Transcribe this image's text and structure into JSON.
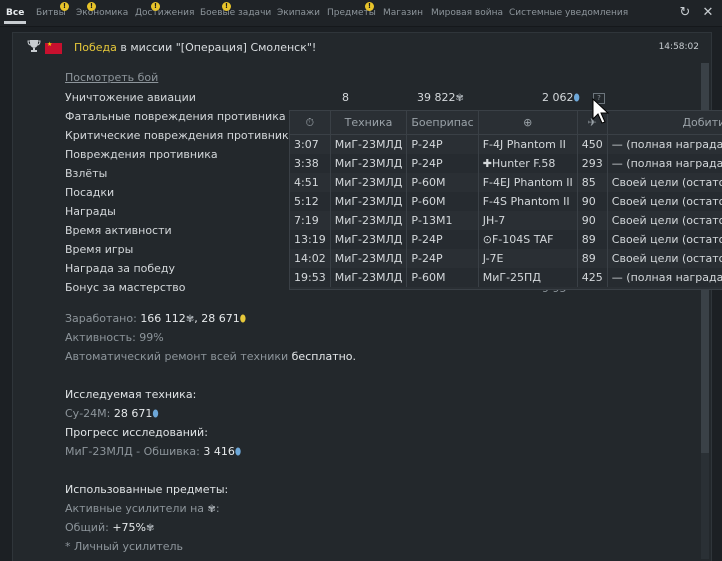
{
  "tabs": [
    {
      "label": "Все",
      "active": true,
      "badge": false
    },
    {
      "label": "Битвы",
      "active": false,
      "badge": true
    },
    {
      "label": "Экономика",
      "active": false,
      "badge": true
    },
    {
      "label": "Достижения",
      "active": false,
      "badge": true
    },
    {
      "label": "Боевые задачи",
      "active": false,
      "badge": true
    },
    {
      "label": "Экипажи",
      "active": false,
      "badge": false
    },
    {
      "label": "Предметы",
      "active": false,
      "badge": true
    },
    {
      "label": "Магазин",
      "active": false,
      "badge": false
    },
    {
      "label": "Мировая война",
      "active": false,
      "badge": false
    },
    {
      "label": "Системные уведомления",
      "active": false,
      "badge": false
    }
  ],
  "badge_symbol": "!",
  "message": {
    "victory_word": "Победа",
    "title_rest": " в миссии \"[Операция] Смоленск\"!",
    "time": "14:58:02",
    "replay_link": "Посмотреть бой"
  },
  "stats": [
    {
      "label": "Уничтожение авиации",
      "count": "8",
      "silver": "39 822",
      "rp": "2 062"
    },
    {
      "label": "Фатальные повреждения противника"
    },
    {
      "label": "Критические повреждения противника"
    },
    {
      "label": "Повреждения противника"
    },
    {
      "label": "Взлёты"
    },
    {
      "label": "Посадки"
    },
    {
      "label": "Награды"
    },
    {
      "label": "Время активности"
    },
    {
      "label": "Время игры"
    },
    {
      "label": "Награда за победу"
    },
    {
      "label": "Бонус за мастерство",
      "partial": "9 95"
    }
  ],
  "qmark": "?",
  "popup": {
    "headers": [
      "⏱",
      "Техника",
      "Боеприпас",
      "⊕",
      "✈",
      "Добитие"
    ],
    "rows": [
      {
        "time": "3:07",
        "vehicle": "МиГ-23МЛД",
        "ammo": "Р-24Р",
        "target": "F-4J Phantom II",
        "mark": "",
        "score": "450",
        "finish": "— (полная награда)"
      },
      {
        "time": "3:38",
        "vehicle": "МиГ-23МЛД",
        "ammo": "Р-24Р",
        "target": "Hunter F.58",
        "mark": "✚",
        "score": "293",
        "finish": "— (полная награда)"
      },
      {
        "time": "4:51",
        "vehicle": "МиГ-23МЛД",
        "ammo": "Р-60М",
        "target": "F-4EJ Phantom II",
        "mark": "",
        "score": "85",
        "finish": "Своей цели (остаток"
      },
      {
        "time": "5:12",
        "vehicle": "МиГ-23МЛД",
        "ammo": "Р-60М",
        "target": "F-4S Phantom II",
        "mark": "",
        "score": "90",
        "finish": "Своей цели (остаток"
      },
      {
        "time": "7:19",
        "vehicle": "МиГ-23МЛД",
        "ammo": "Р-13М1",
        "target": "JH-7",
        "mark": "",
        "score": "90",
        "finish": "Своей цели (остаток"
      },
      {
        "time": "13:19",
        "vehicle": "МиГ-23МЛД",
        "ammo": "Р-24Р",
        "target": "F-104S TAF",
        "mark": "⊙",
        "score": "89",
        "finish": "Своей цели (остаток"
      },
      {
        "time": "14:02",
        "vehicle": "МиГ-23МЛД",
        "ammo": "Р-24Р",
        "target": "J-7E",
        "mark": "",
        "score": "89",
        "finish": "Своей цели (остаток"
      },
      {
        "time": "19:53",
        "vehicle": "МиГ-23МЛД",
        "ammo": "Р-60М",
        "target": "МиГ-25ПД",
        "mark": "",
        "score": "425",
        "finish": "— (полная награда)"
      }
    ]
  },
  "earnings": {
    "earned_label": "Заработано: ",
    "earned_silver": "166 112",
    "earned_sep": ", ",
    "earned_rp": "28 671",
    "activity": "Активность: 99%",
    "repair_label": "Автоматический ремонт всей техники ",
    "repair_value": "бесплатно."
  },
  "research": {
    "header": "Исследуемая техника:",
    "vehicle_label": "Су-24М: ",
    "vehicle_rp": "28 671",
    "progress_header": "Прогресс исследований:",
    "progress_label": "МиГ-23МЛД - Обшивка: ",
    "progress_rp": "3 416"
  },
  "items": {
    "header": "Использованные предметы:",
    "active_label": "Активные усилители на ",
    "active_suffix": ":",
    "total_label": "Общий: ",
    "total_value": "+75%",
    "personal": "* Личный усилитель"
  },
  "colors": {
    "accent": "#e6c83a",
    "rp_blue": "#6da7d8",
    "background": "#1c2024"
  }
}
